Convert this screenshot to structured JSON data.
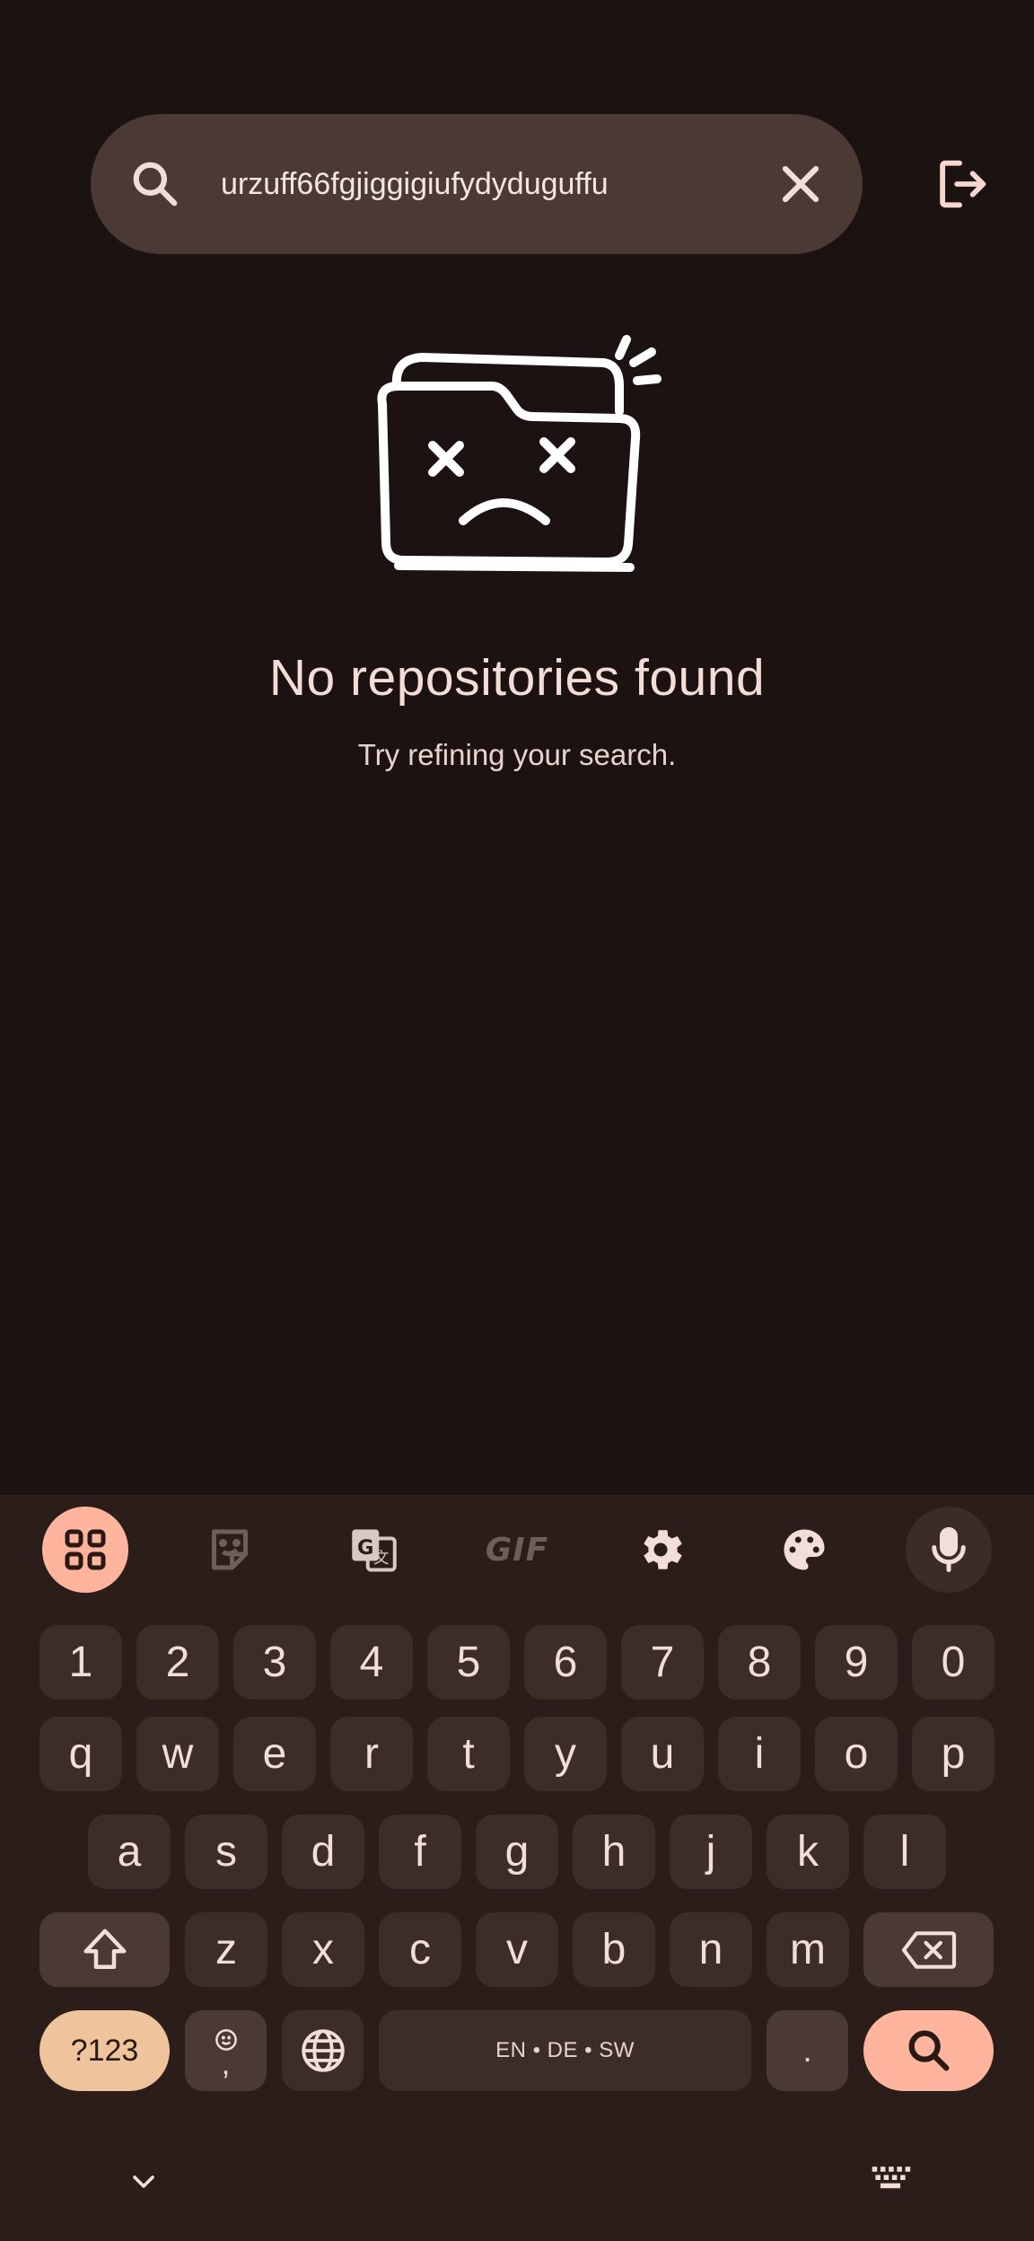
{
  "search": {
    "query": "urzuff66fgjiggigiufydyduguffu",
    "icon": "search-icon",
    "clear_icon": "close-icon"
  },
  "header": {
    "logout_icon": "logout-icon"
  },
  "empty_state": {
    "illustration": "sad-folder-illustration",
    "title": "No repositories found",
    "subtitle": "Try refining your search."
  },
  "keyboard": {
    "toolbar": [
      "apps-grid-icon",
      "sticker-icon",
      "translate-icon",
      "gif-icon",
      "settings-icon",
      "palette-icon",
      "mic-icon"
    ],
    "gif_label": "GIF",
    "row_numbers": [
      "1",
      "2",
      "3",
      "4",
      "5",
      "6",
      "7",
      "8",
      "9",
      "0"
    ],
    "row_q": [
      "q",
      "w",
      "e",
      "r",
      "t",
      "y",
      "u",
      "i",
      "o",
      "p"
    ],
    "row_a": [
      "a",
      "s",
      "d",
      "f",
      "g",
      "h",
      "j",
      "k",
      "l"
    ],
    "row_z": [
      "z",
      "x",
      "c",
      "v",
      "b",
      "n",
      "m"
    ],
    "symbols_label": "?123",
    "comma": ",",
    "space_label": "EN • DE • SW",
    "period": "."
  },
  "colors": {
    "background": "#1c1211",
    "search_bar": "#4a3934",
    "accent": "#ffb59d",
    "key": "#3d2d29",
    "keyboard_bg": "#2b1d19"
  }
}
